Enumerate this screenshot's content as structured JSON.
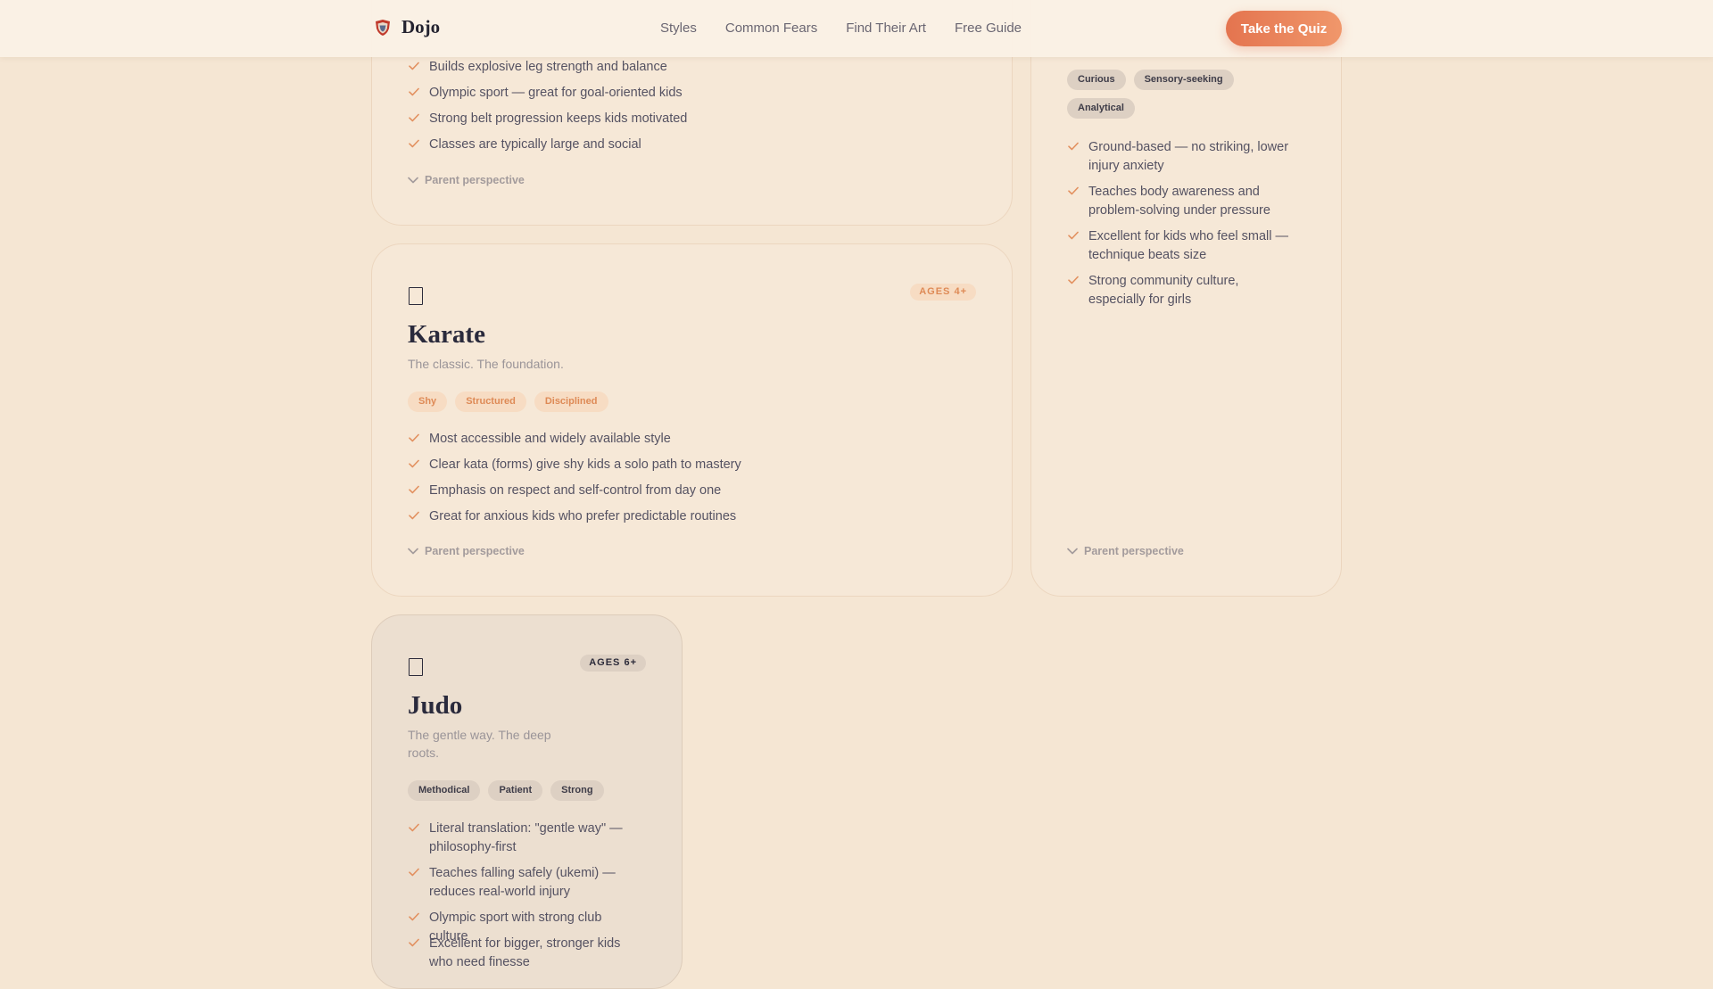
{
  "header": {
    "logo_text": "Dojo",
    "logo_icon": "shield-crest-icon",
    "nav": [
      "Styles",
      "Common Fears",
      "Find Their Art",
      "Free Guide"
    ],
    "cta_label": "Take the Quiz"
  },
  "colors": {
    "accent": "#e4744f",
    "background": "#f5e6d3",
    "check": "#e2905f"
  },
  "top_card": {
    "features": [
      "Builds explosive leg strength and balance",
      "Olympic sport — great for goal-oriented kids",
      "Strong belt progression keeps kids motivated",
      "Classes are typically large and social"
    ],
    "perspective_label": "Parent perspective"
  },
  "karate": {
    "icon": "missing-glyph-icon",
    "age": "AGES 4+",
    "title": "Karate",
    "tagline": "The classic. The foundation.",
    "traits": [
      "Shy",
      "Structured",
      "Disciplined"
    ],
    "features": [
      "Most accessible and widely available style",
      "Clear kata (forms) give shy kids a solo path to mastery",
      "Emphasis on respect and self-control from day one",
      "Great for anxious kids who prefer predictable routines"
    ],
    "perspective_label": "Parent perspective"
  },
  "side_card": {
    "traits": [
      "Curious",
      "Sensory-seeking",
      "Analytical"
    ],
    "features": [
      "Ground-based — no striking, lower injury anxiety",
      "Teaches body awareness and problem-solving under pressure",
      "Excellent for kids who feel small — technique beats size",
      "Strong community culture, especially for girls"
    ],
    "perspective_label": "Parent perspective"
  },
  "judo": {
    "icon": "missing-glyph-icon",
    "age": "AGES 6+",
    "title": "Judo",
    "tagline": "The gentle way. The deep roots.",
    "traits": [
      "Methodical",
      "Patient",
      "Strong"
    ],
    "features": [
      "Literal translation: \"gentle way\" — philosophy-first",
      "Teaches falling safely (ukemi) — reduces real-world injury",
      "Olympic sport with strong club culture",
      "Excellent for bigger, stronger kids who need finesse"
    ]
  }
}
